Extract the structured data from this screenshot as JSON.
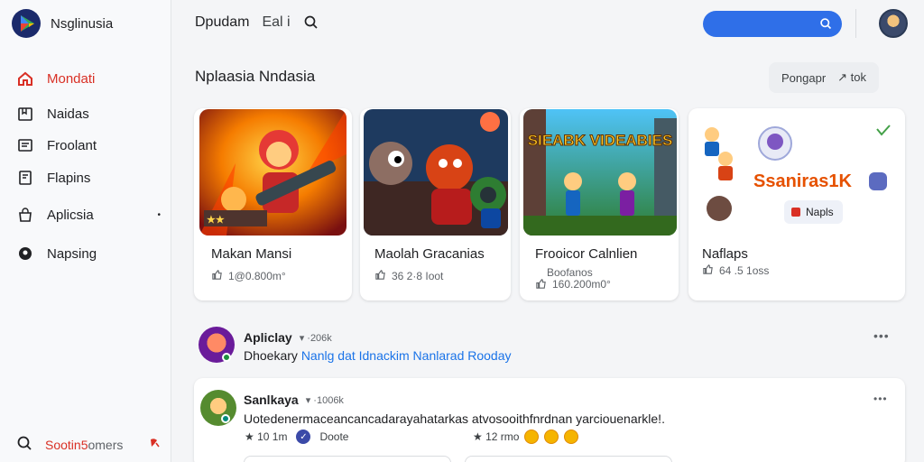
{
  "app": {
    "name": "Nsglinusia"
  },
  "sidebar": {
    "items": [
      {
        "label": "Mondati",
        "icon": "home-icon",
        "active": true
      },
      {
        "label": "Naidas",
        "icon": "bookmark-icon"
      },
      {
        "label": "Froolant",
        "icon": "news-icon"
      },
      {
        "label": "Flapins",
        "icon": "document-icon"
      },
      {
        "label": "Aplicsia",
        "icon": "bag-icon",
        "dot": "•"
      },
      {
        "label": "Napsing",
        "icon": "chat-icon"
      }
    ],
    "footer": {
      "label_main": "Sootin5",
      "label_muted": "omers",
      "icon": "search-circle-icon",
      "pin_icon": "pin-icon"
    }
  },
  "topbar": {
    "title": "Dpudam",
    "subtitle": "Eal i"
  },
  "section": {
    "title": "Nplaasia Nndasia",
    "filter_label": "Pongapr",
    "filter_extra": "↗ tok"
  },
  "cards": [
    {
      "title": "Makan Mansi",
      "meta": "1@0.800m°",
      "art_text": "★★"
    },
    {
      "title": "Maolah Gracanias",
      "meta": "36 2·8 Ioot"
    },
    {
      "title": "Frooicor Calnlien",
      "meta_line1": "Boofanos",
      "meta_line2": "160.200m0°",
      "art_text": "SIEABK VIDEABIES"
    },
    {
      "title": "Naflaps",
      "meta": "64 .5 1oss",
      "art_text": "Ssaniras1K",
      "chip": "Napls"
    }
  ],
  "posts": [
    {
      "name": "Apliclay",
      "meta": "▾  ·206k",
      "text_plain": "Dhoekary",
      "text_link": "Nanlg dat Idnackim Nanlarad Rooday"
    },
    {
      "name": "Sanlkaya",
      "meta": "▾  ·1006k",
      "text": "Uotedenermaceancancadarayahatarkas atvosooithfnrdnan yarciouenarkle!.",
      "stat1": "★ 10 1m",
      "done": "Doote",
      "stat2": "★ 12 rmo"
    }
  ],
  "colors": {
    "accent": "#2f6fe8",
    "active": "#d93025",
    "link": "#1a73e8"
  }
}
